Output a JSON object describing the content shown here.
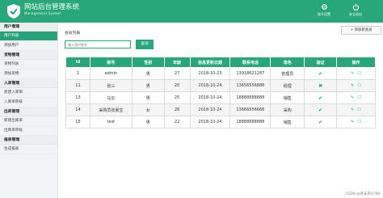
{
  "header": {
    "title": "网站后台管理系统",
    "subtitle": "Management System",
    "btn_settings": "账号设置",
    "btn_logout": "安全退出"
  },
  "sidebar": [
    {
      "title": "用户管理",
      "items": [
        {
          "label": "用户列表",
          "active": true
        },
        {
          "label": "添加用户",
          "active": false
        }
      ]
    },
    {
      "title": "货物管理",
      "items": [
        {
          "label": "货物列表",
          "active": false
        },
        {
          "label": "添加货物",
          "active": false
        }
      ]
    },
    {
      "title": "入库管理",
      "items": [
        {
          "label": "新建入库单",
          "active": false
        },
        {
          "label": "入库单审核",
          "active": false
        }
      ]
    },
    {
      "title": "出库管理",
      "items": [
        {
          "label": "新建出库单",
          "active": false
        },
        {
          "label": "出库单审核",
          "active": false
        }
      ]
    },
    {
      "title": "报表管理",
      "items": [
        {
          "label": "生成报表",
          "active": false
        }
      ]
    }
  ],
  "main": {
    "page_title": "会员列表",
    "add_button": "添加新会员",
    "search_placeholder": "输入用户姓名",
    "search_button": "查询",
    "columns": [
      "Id",
      "账号",
      "性别",
      "年龄",
      "信息更新日期",
      "联系电话",
      "角色",
      "验证",
      "操作"
    ],
    "rows": [
      {
        "id": "1",
        "account": "admin",
        "gender": "男",
        "age": "27",
        "date": "2018-10-23",
        "phone": "13918621287",
        "role": "管理员",
        "verified": true
      },
      {
        "id": "11",
        "account": "张三",
        "gender": "男",
        "age": "20",
        "date": "2018-10-24",
        "phone": "13656556888",
        "role": "经理",
        "verified": false
      },
      {
        "id": "13",
        "account": "马云",
        "gender": "男",
        "age": "25",
        "date": "2018-10-24",
        "phone": "18888888888",
        "role": "销售",
        "verified": true
      },
      {
        "id": "14",
        "account": "采购员张晨宝",
        "gender": "女",
        "age": "26",
        "date": "2018-10-24",
        "phone": "13666556666",
        "role": "采购",
        "verified": true
      },
      {
        "id": "15",
        "account": "test",
        "gender": "男",
        "age": "22",
        "date": "2018-10-24",
        "phone": "18888888888",
        "role": "销售",
        "verified": true
      }
    ]
  },
  "watermark": "CSDN @意未央5788"
}
